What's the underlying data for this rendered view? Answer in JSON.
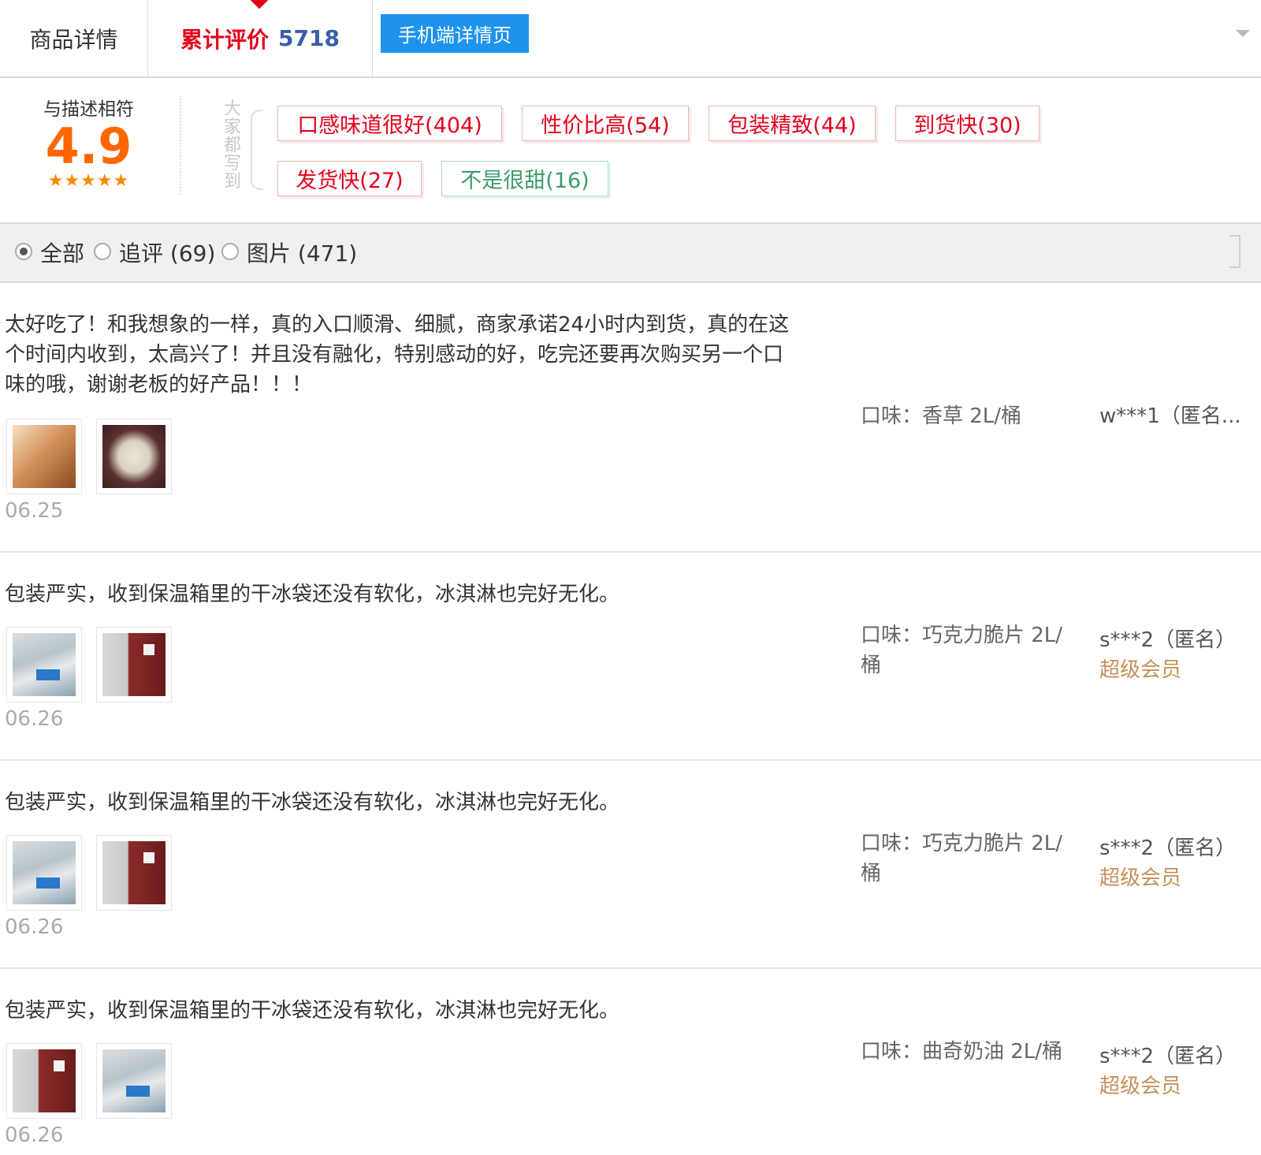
{
  "tabs": {
    "details_label": "商品详情",
    "reviews_label": "累计评价",
    "reviews_count": "5718",
    "mobile_label": "手机端详情页"
  },
  "summary": {
    "label": "与描述相符",
    "score": "4.9",
    "stars": "★★★★★",
    "everyone_label": "大家都写到",
    "tags": [
      {
        "label": "口感味道很好(404)",
        "sentiment": "positive"
      },
      {
        "label": "性价比高(54)",
        "sentiment": "positive"
      },
      {
        "label": "包装精致(44)",
        "sentiment": "positive"
      },
      {
        "label": "到货快(30)",
        "sentiment": "positive"
      },
      {
        "label": "发货快(27)",
        "sentiment": "positive"
      },
      {
        "label": "不是很甜(16)",
        "sentiment": "negative"
      }
    ]
  },
  "filters": {
    "all_label": "全部",
    "followup_label": "追评 (69)",
    "photos_label": "图片 (471)",
    "selected": "all"
  },
  "reviews": [
    {
      "text": "太好吃了！和我想象的一样，真的入口顺滑、细腻，商家承诺24小时内到货，真的在这个时间内收到，太高兴了！并且没有融化，特别感动的好，吃完还要再次购买另一个口味的哦，谢谢老板的好产品！！！",
      "date": "06.25",
      "sku": "口味：香草 2L/桶",
      "user": "w***1（匿名...",
      "member": ""
    },
    {
      "text": "包装严实，收到保温箱里的干冰袋还没有软化，冰淇淋也完好无化。",
      "date": "06.26",
      "sku": "口味：巧克力脆片 2L/桶",
      "user": "s***2（匿名）",
      "member": "超级会员"
    },
    {
      "text": "包装严实，收到保温箱里的干冰袋还没有软化，冰淇淋也完好无化。",
      "date": "06.26",
      "sku": "口味：巧克力脆片 2L/桶",
      "user": "s***2（匿名）",
      "member": "超级会员"
    },
    {
      "text": "包装严实，收到保温箱里的干冰袋还没有软化，冰淇淋也完好无化。",
      "date": "06.26",
      "sku": "口味：曲奇奶油 2L/桶",
      "user": "s***2（匿名）",
      "member": "超级会员"
    }
  ],
  "colors": {
    "accent_red": "#e4001c",
    "score_orange": "#ff6600",
    "mobile_blue": "#1e93ee",
    "member_gold": "#c3915a",
    "negative_green": "#3d9c69"
  }
}
